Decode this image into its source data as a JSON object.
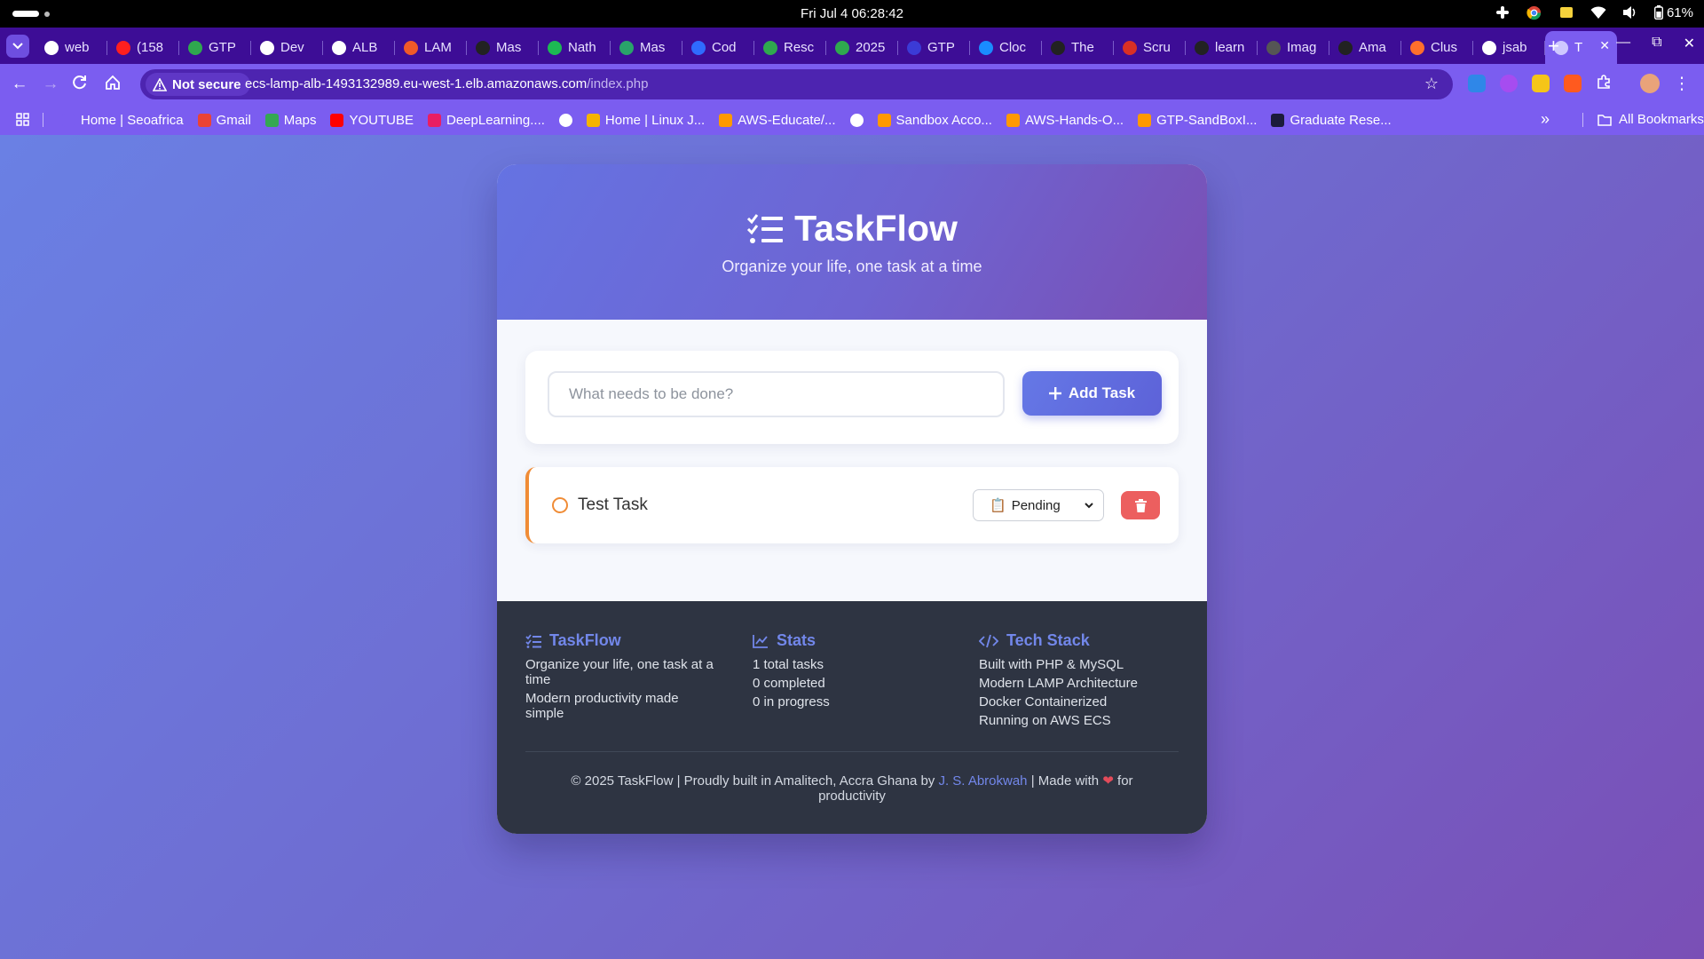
{
  "os": {
    "clock": "Fri Jul 4  06:28:42",
    "battery": "61%"
  },
  "browser": {
    "tabs": [
      {
        "label": "web",
        "color": "#ffffff"
      },
      {
        "label": "(158",
        "color": "#ff1f1f"
      },
      {
        "label": "GTP",
        "color": "#2fa84f"
      },
      {
        "label": "Dev",
        "color": "#ffffff"
      },
      {
        "label": "ALB",
        "color": "#ffffff"
      },
      {
        "label": "LAM",
        "color": "#f05a28"
      },
      {
        "label": "Mas",
        "color": "#222222"
      },
      {
        "label": "Nath",
        "color": "#1db954"
      },
      {
        "label": "Mas",
        "color": "#29a36a"
      },
      {
        "label": "Cod",
        "color": "#2f6bff"
      },
      {
        "label": "Resc",
        "color": "#2fa84f"
      },
      {
        "label": "2025",
        "color": "#2fa84f"
      },
      {
        "label": "GTP",
        "color": "#3b3bd6"
      },
      {
        "label": "Cloc",
        "color": "#1a8cff"
      },
      {
        "label": "The",
        "color": "#222222"
      },
      {
        "label": "Scru",
        "color": "#d93025"
      },
      {
        "label": "learn",
        "color": "#222222"
      },
      {
        "label": "Imag",
        "color": "#555555"
      },
      {
        "label": "Ama",
        "color": "#222222"
      },
      {
        "label": "Clus",
        "color": "#ff6f2c"
      },
      {
        "label": "jsab",
        "color": "#ffffff"
      },
      {
        "label": "T",
        "color": "#cfc8ff"
      }
    ],
    "new_tab": "+",
    "security_label": "Not secure",
    "url_host": "ecs-lamp-alb-1493132989.eu-west-1.elb.amazonaws.com",
    "url_path": "/index.php",
    "bookmarks": [
      {
        "label": "Home | Seoafrica",
        "color": "#7b5df0"
      },
      {
        "label": "Gmail",
        "color": "#ea4335"
      },
      {
        "label": "Maps",
        "color": "#34a853"
      },
      {
        "label": "YOUTUBE",
        "color": "#ff0000"
      },
      {
        "label": "DeepLearning....",
        "color": "#e91e63"
      },
      {
        "label": "",
        "color": "#ffffff"
      },
      {
        "label": "Home | Linux J...",
        "color": "#f5b400"
      },
      {
        "label": "AWS-Educate/...",
        "color": "#ff9900"
      },
      {
        "label": "",
        "color": "#ffffff"
      },
      {
        "label": "Sandbox Acco...",
        "color": "#ff9900"
      },
      {
        "label": "AWS-Hands-O...",
        "color": "#ff9900"
      },
      {
        "label": "GTP-SandBoxI...",
        "color": "#ff9900"
      },
      {
        "label": "Graduate Rese...",
        "color": "#1b1b3a"
      }
    ],
    "all_bookmarks": "All Bookmarks"
  },
  "app": {
    "title": "TaskFlow",
    "tagline": "Organize your life, one task at a time",
    "input_placeholder": "What needs to be done?",
    "add_button": "Add Task",
    "tasks": [
      {
        "title": "Test Task",
        "status": "Pending",
        "status_icon": "📋",
        "accent": "#f08c36"
      }
    ],
    "footer": {
      "about": {
        "heading": "TaskFlow",
        "lines": [
          "Organize your life, one task at a time",
          "Modern productivity made simple"
        ]
      },
      "stats": {
        "heading": "Stats",
        "lines": [
          "1 total tasks",
          "0 completed",
          "0 in progress"
        ]
      },
      "tech": {
        "heading": "Tech Stack",
        "lines": [
          "Built with PHP & MySQL",
          "Modern LAMP Architecture",
          "Docker Containerized",
          "Running on AWS ECS"
        ]
      },
      "copy_prefix": "© 2025 TaskFlow | Proudly built in Amalitech, Accra Ghana by ",
      "author": "J. S. Abrokwah",
      "copy_mid": " | Made with ",
      "heart": "❤",
      "copy_suffix": " for productivity"
    }
  },
  "colors": {
    "accent": "#6578e6",
    "danger": "#ec5f5f",
    "pending": "#f08c36",
    "footer_bg": "#2e3442"
  }
}
